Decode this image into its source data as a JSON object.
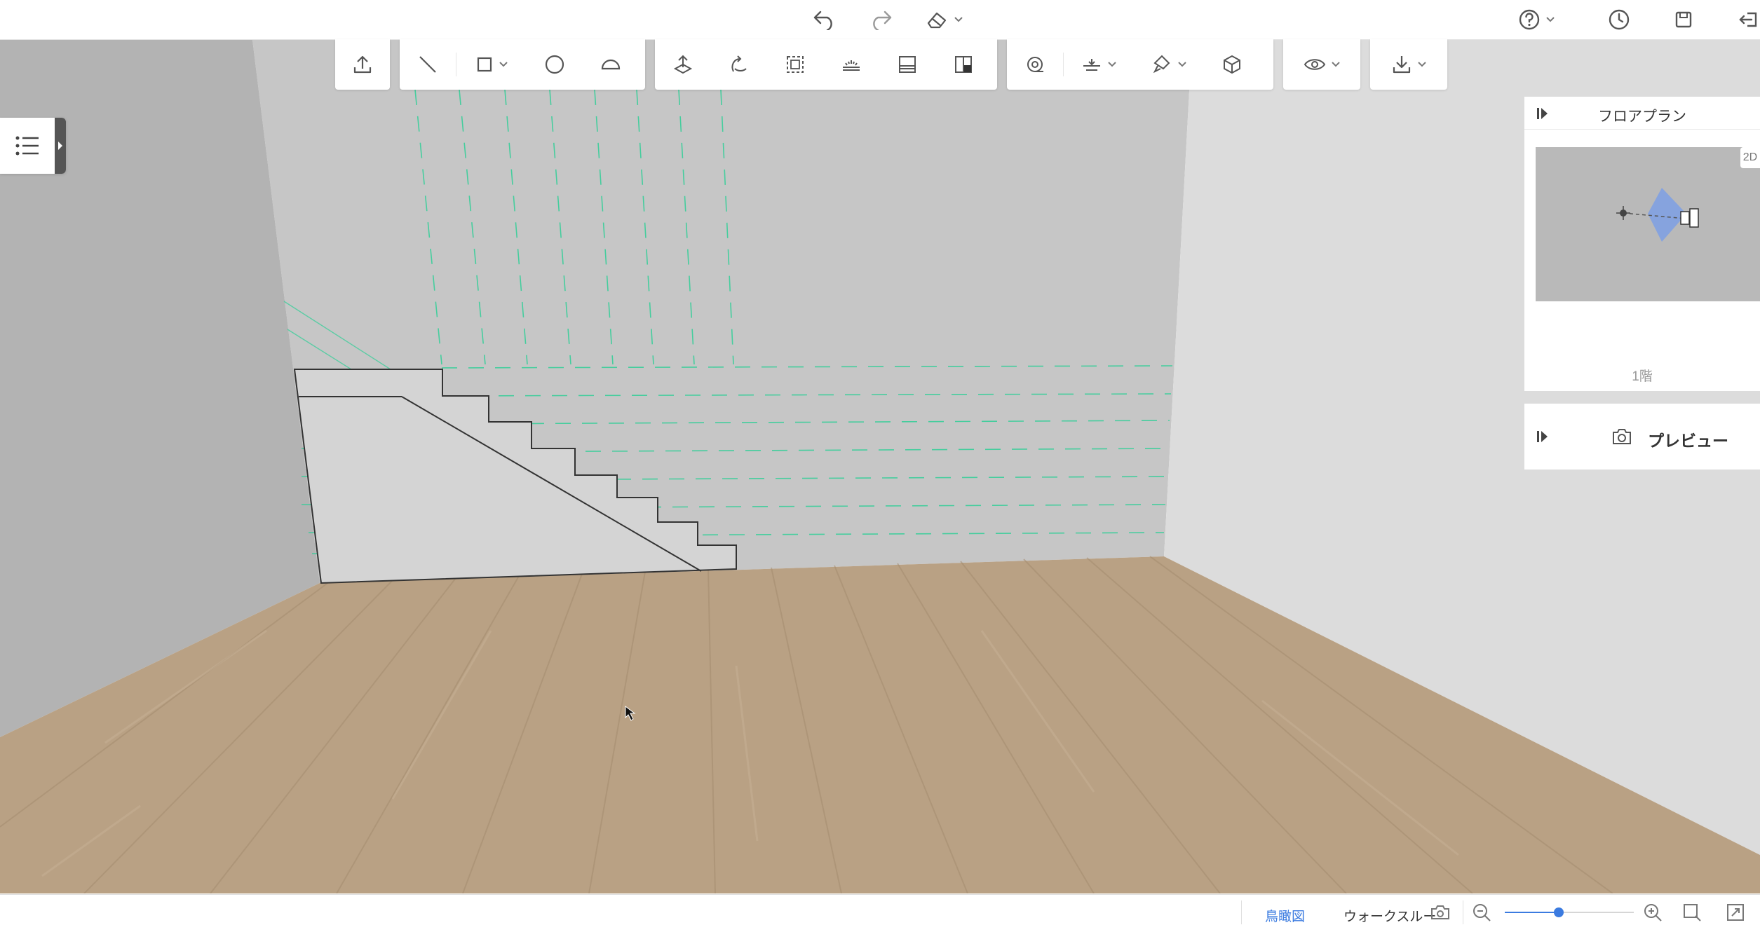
{
  "colors": {
    "accent": "#3b7be0",
    "guide": "#2fcf97",
    "floor": "#b9a184",
    "wall_back": "#c6c6c6"
  },
  "topbar": {
    "icons": [
      "undo-icon",
      "redo-icon",
      "eraser-icon",
      "help-icon",
      "history-icon",
      "save-icon",
      "exit-icon"
    ]
  },
  "toolbar": {
    "groups": [
      [
        "upload-icon"
      ],
      [
        "line-icon",
        "rectangle-icon",
        "circle-icon",
        "arc-icon"
      ],
      [
        "push-pull-icon",
        "rotate-icon",
        "select-area-icon",
        "light-icon",
        "wall-panel-icon",
        "layout-icon"
      ],
      [
        "tape-measure-icon",
        "align-icon",
        "paint-icon",
        "box-view-icon"
      ],
      [
        "eye-icon"
      ],
      [
        "download-icon"
      ]
    ]
  },
  "floorplan_panel": {
    "title": "フロアプラン",
    "mode_label": "2D",
    "floor_label": "1階"
  },
  "preview_panel": {
    "title": "プレビュー"
  },
  "statusbar": {
    "view_birdseye": "鳥瞰図",
    "view_walkthrough": "ウォークスルー",
    "zoom_level": 0.42
  }
}
